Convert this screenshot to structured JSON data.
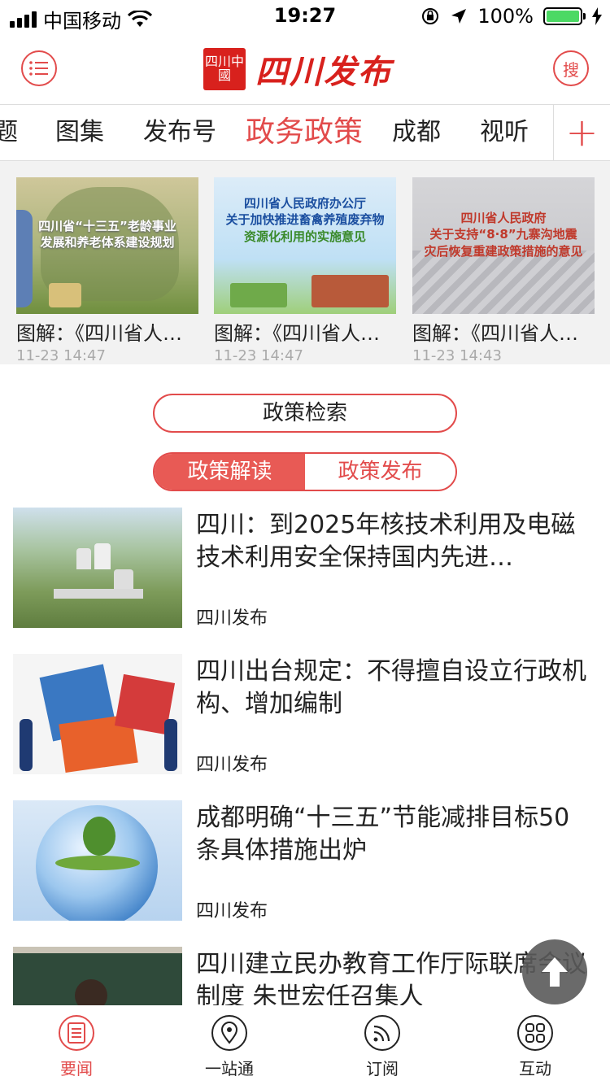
{
  "status_bar": {
    "carrier": "中国移动",
    "time": "19:27",
    "battery_percent": "100%",
    "battery_level": 1.0
  },
  "header": {
    "logo_seal": "四川中國",
    "logo_text": "四川发布",
    "search_label": "搜"
  },
  "tabs": {
    "items": [
      {
        "label": "题"
      },
      {
        "label": "图集"
      },
      {
        "label": "发布号"
      },
      {
        "label": "政务政策",
        "active": true
      },
      {
        "label": "成都"
      },
      {
        "label": "视听"
      }
    ],
    "add_label": "+"
  },
  "cards": [
    {
      "caption_lines": [
        "四川省“十三五”老龄事业",
        "发展和养老体系建设规划"
      ],
      "title": "图解：《四川省人…",
      "time": "11-23 14:47"
    },
    {
      "caption_lines": [
        "四川省人民政府办公厅",
        "关于加快推进畜禽养殖废弃物",
        "资源化利用的实施意见"
      ],
      "title": "图解：《四川省人…",
      "time": "11-23 14:47"
    },
    {
      "caption_lines": [
        "四川省人民政府",
        "关于支持“8·8”九寨沟地震",
        "灾后恢复重建政策措施的意见"
      ],
      "title": "图解：《四川省人…",
      "time": "11-23 14:43"
    }
  ],
  "policy_search_label": "政策检索",
  "segment": {
    "left_label": "政策解读",
    "right_label": "政策发布"
  },
  "news": [
    {
      "title": "四川：到2025年核技术利用及电磁技术利用安全保持国内先进…",
      "source": "四川发布"
    },
    {
      "title": "四川出台规定：不得擅自设立行政机构、增加编制",
      "source": "四川发布"
    },
    {
      "title": "成都明确“十三五”节能减排目标50条具体措施出炉",
      "source": "四川发布"
    },
    {
      "title": "四川建立民办教育工作厅际联席会议制度 朱世宏任召集人",
      "source": ""
    }
  ],
  "tabbar": {
    "items": [
      {
        "label": "要闻",
        "icon": "news-icon",
        "active": true
      },
      {
        "label": "一站通",
        "icon": "location-icon"
      },
      {
        "label": "订阅",
        "icon": "rss-icon"
      },
      {
        "label": "互动",
        "icon": "grid-icon"
      }
    ]
  },
  "colors": {
    "accent": "#e24b4b",
    "brand_red": "#d8211d"
  }
}
